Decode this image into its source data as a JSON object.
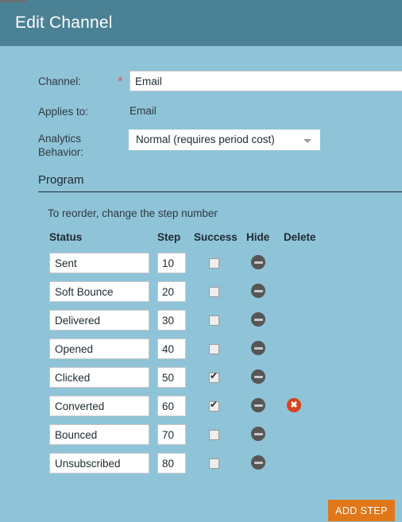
{
  "window": {
    "title": "Edit Channel"
  },
  "form": {
    "channel": {
      "label": "Channel:",
      "required_marker": "*",
      "value": "Email",
      "placeholder": ""
    },
    "applies_to": {
      "label": "Applies to:",
      "value": "Email"
    },
    "analytics_behavior": {
      "label_line1": "Analytics",
      "label_line2": "Behavior:",
      "selected": "Normal (requires period cost)",
      "arrow_icon": "chevron-down-icon"
    }
  },
  "program": {
    "section_title": "Program",
    "hint": "To reorder, change the step number",
    "columns": [
      "Status",
      "Step",
      "Success",
      "Hide",
      "Delete"
    ],
    "rows": [
      {
        "status": "Sent",
        "step": "10",
        "success": false,
        "hide": true,
        "delete": false
      },
      {
        "status": "Soft Bounce",
        "step": "20",
        "success": false,
        "hide": true,
        "delete": false
      },
      {
        "status": "Delivered",
        "step": "30",
        "success": false,
        "hide": true,
        "delete": false
      },
      {
        "status": "Opened",
        "step": "40",
        "success": false,
        "hide": true,
        "delete": false
      },
      {
        "status": "Clicked",
        "step": "50",
        "success": true,
        "hide": true,
        "delete": false
      },
      {
        "status": "Converted",
        "step": "60",
        "success": true,
        "hide": true,
        "delete": true
      },
      {
        "status": "Bounced",
        "step": "70",
        "success": false,
        "hide": true,
        "delete": false
      },
      {
        "status": "Unsubscribed",
        "step": "80",
        "success": false,
        "hide": true,
        "delete": false
      }
    ],
    "add_step_label": "ADD STEP"
  },
  "colors": {
    "header_bar": "#4b8195",
    "body_background": "#8fc3d8",
    "accent_button": "#e0771a",
    "delete_icon": "#d6441f",
    "required_star": "#d05a5a",
    "hide_icon": "#565656"
  }
}
